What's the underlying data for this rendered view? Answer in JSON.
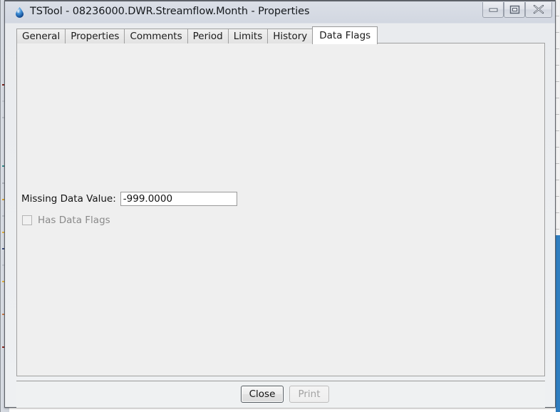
{
  "window": {
    "title": "TSTool - 08236000.DWR.Streamflow.Month - Properties",
    "app_icon": "water-drop-icon",
    "controls": {
      "minimize_name": "minimize-button",
      "maximize_name": "maximize-button",
      "close_name": "close-window-button"
    },
    "titlebar_color": "#d6dae3",
    "panel_color": "#efefef"
  },
  "tabs": [
    {
      "label": "General",
      "selected": false
    },
    {
      "label": "Properties",
      "selected": false
    },
    {
      "label": "Comments",
      "selected": false
    },
    {
      "label": "Period",
      "selected": false
    },
    {
      "label": "Limits",
      "selected": false
    },
    {
      "label": "History",
      "selected": false
    },
    {
      "label": "Data Flags",
      "selected": true
    }
  ],
  "data_flags_panel": {
    "missing_data_value": {
      "label": "Missing Data Value:",
      "value": "-999.0000",
      "placeholder": ""
    },
    "has_data_flags": {
      "label": "Has Data Flags",
      "checked": false,
      "enabled": false
    }
  },
  "buttons": {
    "close": {
      "label": "Close",
      "enabled": true
    },
    "print": {
      "label": "Print",
      "enabled": false
    }
  }
}
